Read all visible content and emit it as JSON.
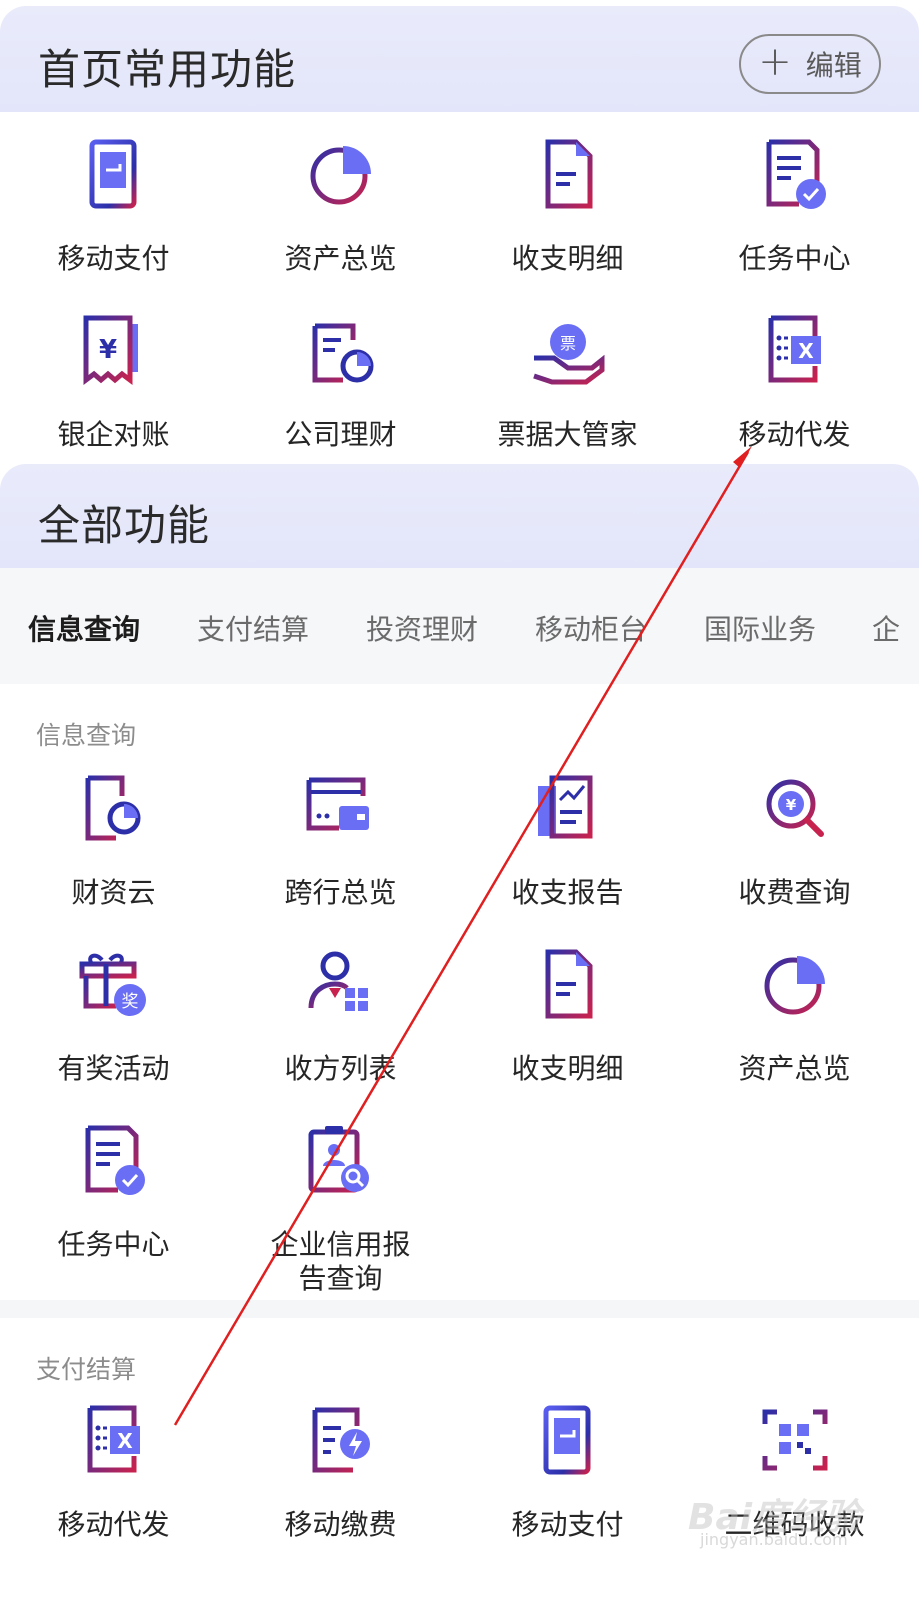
{
  "home": {
    "title": "首页常用功能",
    "edit_label": "编辑",
    "items": [
      {
        "label": "移动支付",
        "icon": "mobile-payment-icon"
      },
      {
        "label": "资产总览",
        "icon": "pie-chart-icon"
      },
      {
        "label": "收支明细",
        "icon": "document-icon"
      },
      {
        "label": "任务中心",
        "icon": "task-check-icon"
      },
      {
        "label": "银企对账",
        "icon": "receipt-yuan-icon"
      },
      {
        "label": "公司理财",
        "icon": "finance-chart-icon"
      },
      {
        "label": "票据大管家",
        "icon": "bill-hand-icon"
      },
      {
        "label": "移动代发",
        "icon": "excel-list-icon"
      }
    ]
  },
  "all": {
    "title": "全部功能",
    "tabs": [
      "信息查询",
      "支付结算",
      "投资理财",
      "移动柜台",
      "国际业务",
      "企"
    ],
    "groups": [
      {
        "label": "信息查询",
        "items": [
          {
            "label": "财资云",
            "icon": "cloud-chart-icon"
          },
          {
            "label": "跨行总览",
            "icon": "wallet-screen-icon"
          },
          {
            "label": "收支报告",
            "icon": "report-book-icon"
          },
          {
            "label": "收费查询",
            "icon": "search-yuan-icon"
          },
          {
            "label": "有奖活动",
            "icon": "gift-icon"
          },
          {
            "label": "收方列表",
            "icon": "user-grid-icon"
          },
          {
            "label": "收支明细",
            "icon": "document-icon"
          },
          {
            "label": "资产总览",
            "icon": "pie-chart-icon"
          },
          {
            "label": "任务中心",
            "icon": "task-check-icon"
          },
          {
            "label": "企业信用报",
            "label2": "告查询",
            "icon": "credit-search-icon"
          }
        ]
      },
      {
        "label": "支付结算",
        "items": [
          {
            "label": "移动代发",
            "icon": "excel-list-icon"
          },
          {
            "label": "移动缴费",
            "icon": "payment-bolt-icon"
          },
          {
            "label": "移动支付",
            "icon": "mobile-payment-icon"
          },
          {
            "label": "二维码收款",
            "icon": "qr-code-icon"
          }
        ]
      }
    ]
  },
  "watermark": {
    "text": "Bai度经验",
    "sub": "jingyan.baidu.com"
  },
  "colors": {
    "primary": "#2c2fa8",
    "accent": "#5a5ef0",
    "red": "#c8224e",
    "annotation": "#e02020"
  }
}
